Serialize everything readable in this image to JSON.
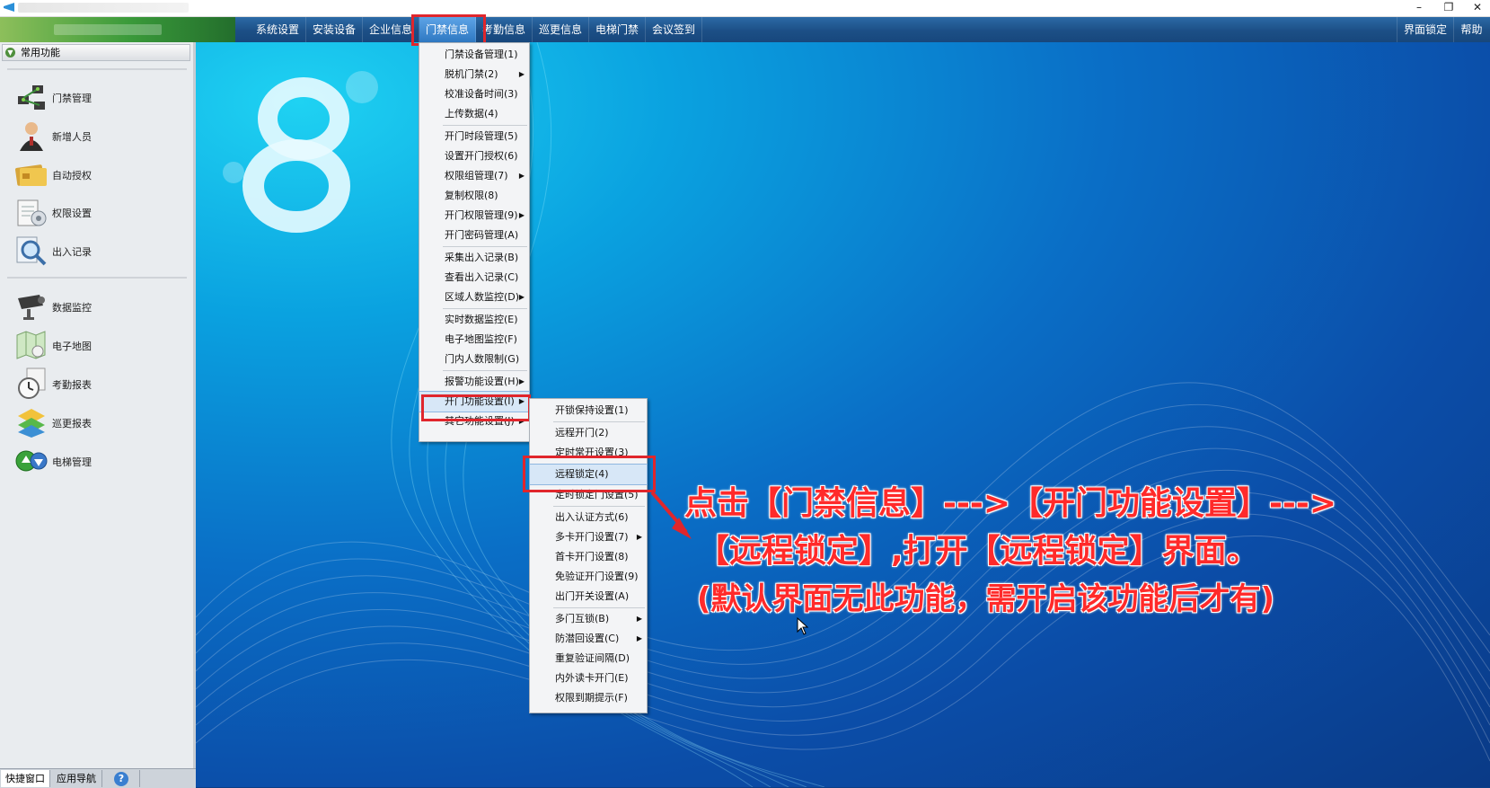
{
  "window": {
    "title": "",
    "controls": {
      "minimize": "–",
      "restore": "❐",
      "close": "✕"
    }
  },
  "menubar": {
    "items": [
      "系统设置",
      "安装设备",
      "企业信息",
      "门禁信息",
      "考勤信息",
      "巡更信息",
      "电梯门禁",
      "会议签到"
    ],
    "right_items": [
      "界面锁定",
      "帮助"
    ],
    "active": "门禁信息"
  },
  "sidebar": {
    "header": "常用功能",
    "items": [
      {
        "label": "门禁管理",
        "icon": "door-network-icon"
      },
      {
        "label": "新增人员",
        "icon": "person-icon"
      },
      {
        "label": "自动授权",
        "icon": "card-icon"
      },
      {
        "label": "权限设置",
        "icon": "permission-doc-icon"
      },
      {
        "label": "出入记录",
        "icon": "magnifier-icon"
      },
      {
        "label": "数据监控",
        "icon": "camera-icon"
      },
      {
        "label": "电子地图",
        "icon": "map-icon"
      },
      {
        "label": "考勤报表",
        "icon": "clock-icon"
      },
      {
        "label": "巡更报表",
        "icon": "patrol-icon"
      },
      {
        "label": "电梯管理",
        "icon": "elevator-icon"
      }
    ]
  },
  "bottom_tabs": [
    "快捷窗口",
    "应用导航",
    "?"
  ],
  "menu_access": {
    "items": [
      {
        "label": "门禁设备管理(1)",
        "submenu": false
      },
      {
        "label": "脱机门禁(2)",
        "submenu": true
      },
      {
        "label": "校准设备时间(3)",
        "submenu": false
      },
      {
        "label": "上传数据(4)",
        "submenu": false
      },
      {
        "label": "开门时段管理(5)",
        "submenu": false
      },
      {
        "label": "设置开门授权(6)",
        "submenu": false
      },
      {
        "label": "权限组管理(7)",
        "submenu": true
      },
      {
        "label": "复制权限(8)",
        "submenu": false
      },
      {
        "label": "开门权限管理(9)",
        "submenu": true
      },
      {
        "label": "开门密码管理(A)",
        "submenu": false
      },
      {
        "label": "采集出入记录(B)",
        "submenu": false
      },
      {
        "label": "查看出入记录(C)",
        "submenu": false
      },
      {
        "label": "区域人数监控(D)",
        "submenu": true
      },
      {
        "label": "实时数据监控(E)",
        "submenu": false
      },
      {
        "label": "电子地图监控(F)",
        "submenu": false
      },
      {
        "label": "门内人数限制(G)",
        "submenu": false
      },
      {
        "label": "报警功能设置(H)",
        "submenu": true
      },
      {
        "label": "开门功能设置(I)",
        "submenu": true
      },
      {
        "label": "其它功能设置(J)",
        "submenu": true
      }
    ]
  },
  "menu_open_function": {
    "items": [
      {
        "label": "开锁保持设置(1)",
        "submenu": false
      },
      {
        "label": "远程开门(2)",
        "submenu": false
      },
      {
        "label": "定时常开设置(3)",
        "submenu": false
      },
      {
        "label": "远程锁定(4)",
        "submenu": false
      },
      {
        "label": "定时锁定门设置(5)",
        "submenu": false
      },
      {
        "label": "出入认证方式(6)",
        "submenu": false
      },
      {
        "label": "多卡开门设置(7)",
        "submenu": true
      },
      {
        "label": "首卡开门设置(8)",
        "submenu": false
      },
      {
        "label": "免验证开门设置(9)",
        "submenu": false
      },
      {
        "label": "出门开关设置(A)",
        "submenu": false
      },
      {
        "label": "多门互锁(B)",
        "submenu": true
      },
      {
        "label": "防潜回设置(C)",
        "submenu": true
      },
      {
        "label": "重复验证间隔(D)",
        "submenu": false
      },
      {
        "label": "内外读卡开门(E)",
        "submenu": false
      },
      {
        "label": "权限到期提示(F)",
        "submenu": false
      }
    ]
  },
  "annotation": {
    "line1": "点击【门禁信息】--->【开门功能设置】--->",
    "line2": "【远程锁定】,打开【远程锁定】界面。",
    "line3": "(默认界面无此功能，需开启该功能后才有)"
  },
  "colors": {
    "accent_red": "#e0262c",
    "menubar_blue": "#1c4f86",
    "menu_highlight": "#d7e7f7"
  }
}
